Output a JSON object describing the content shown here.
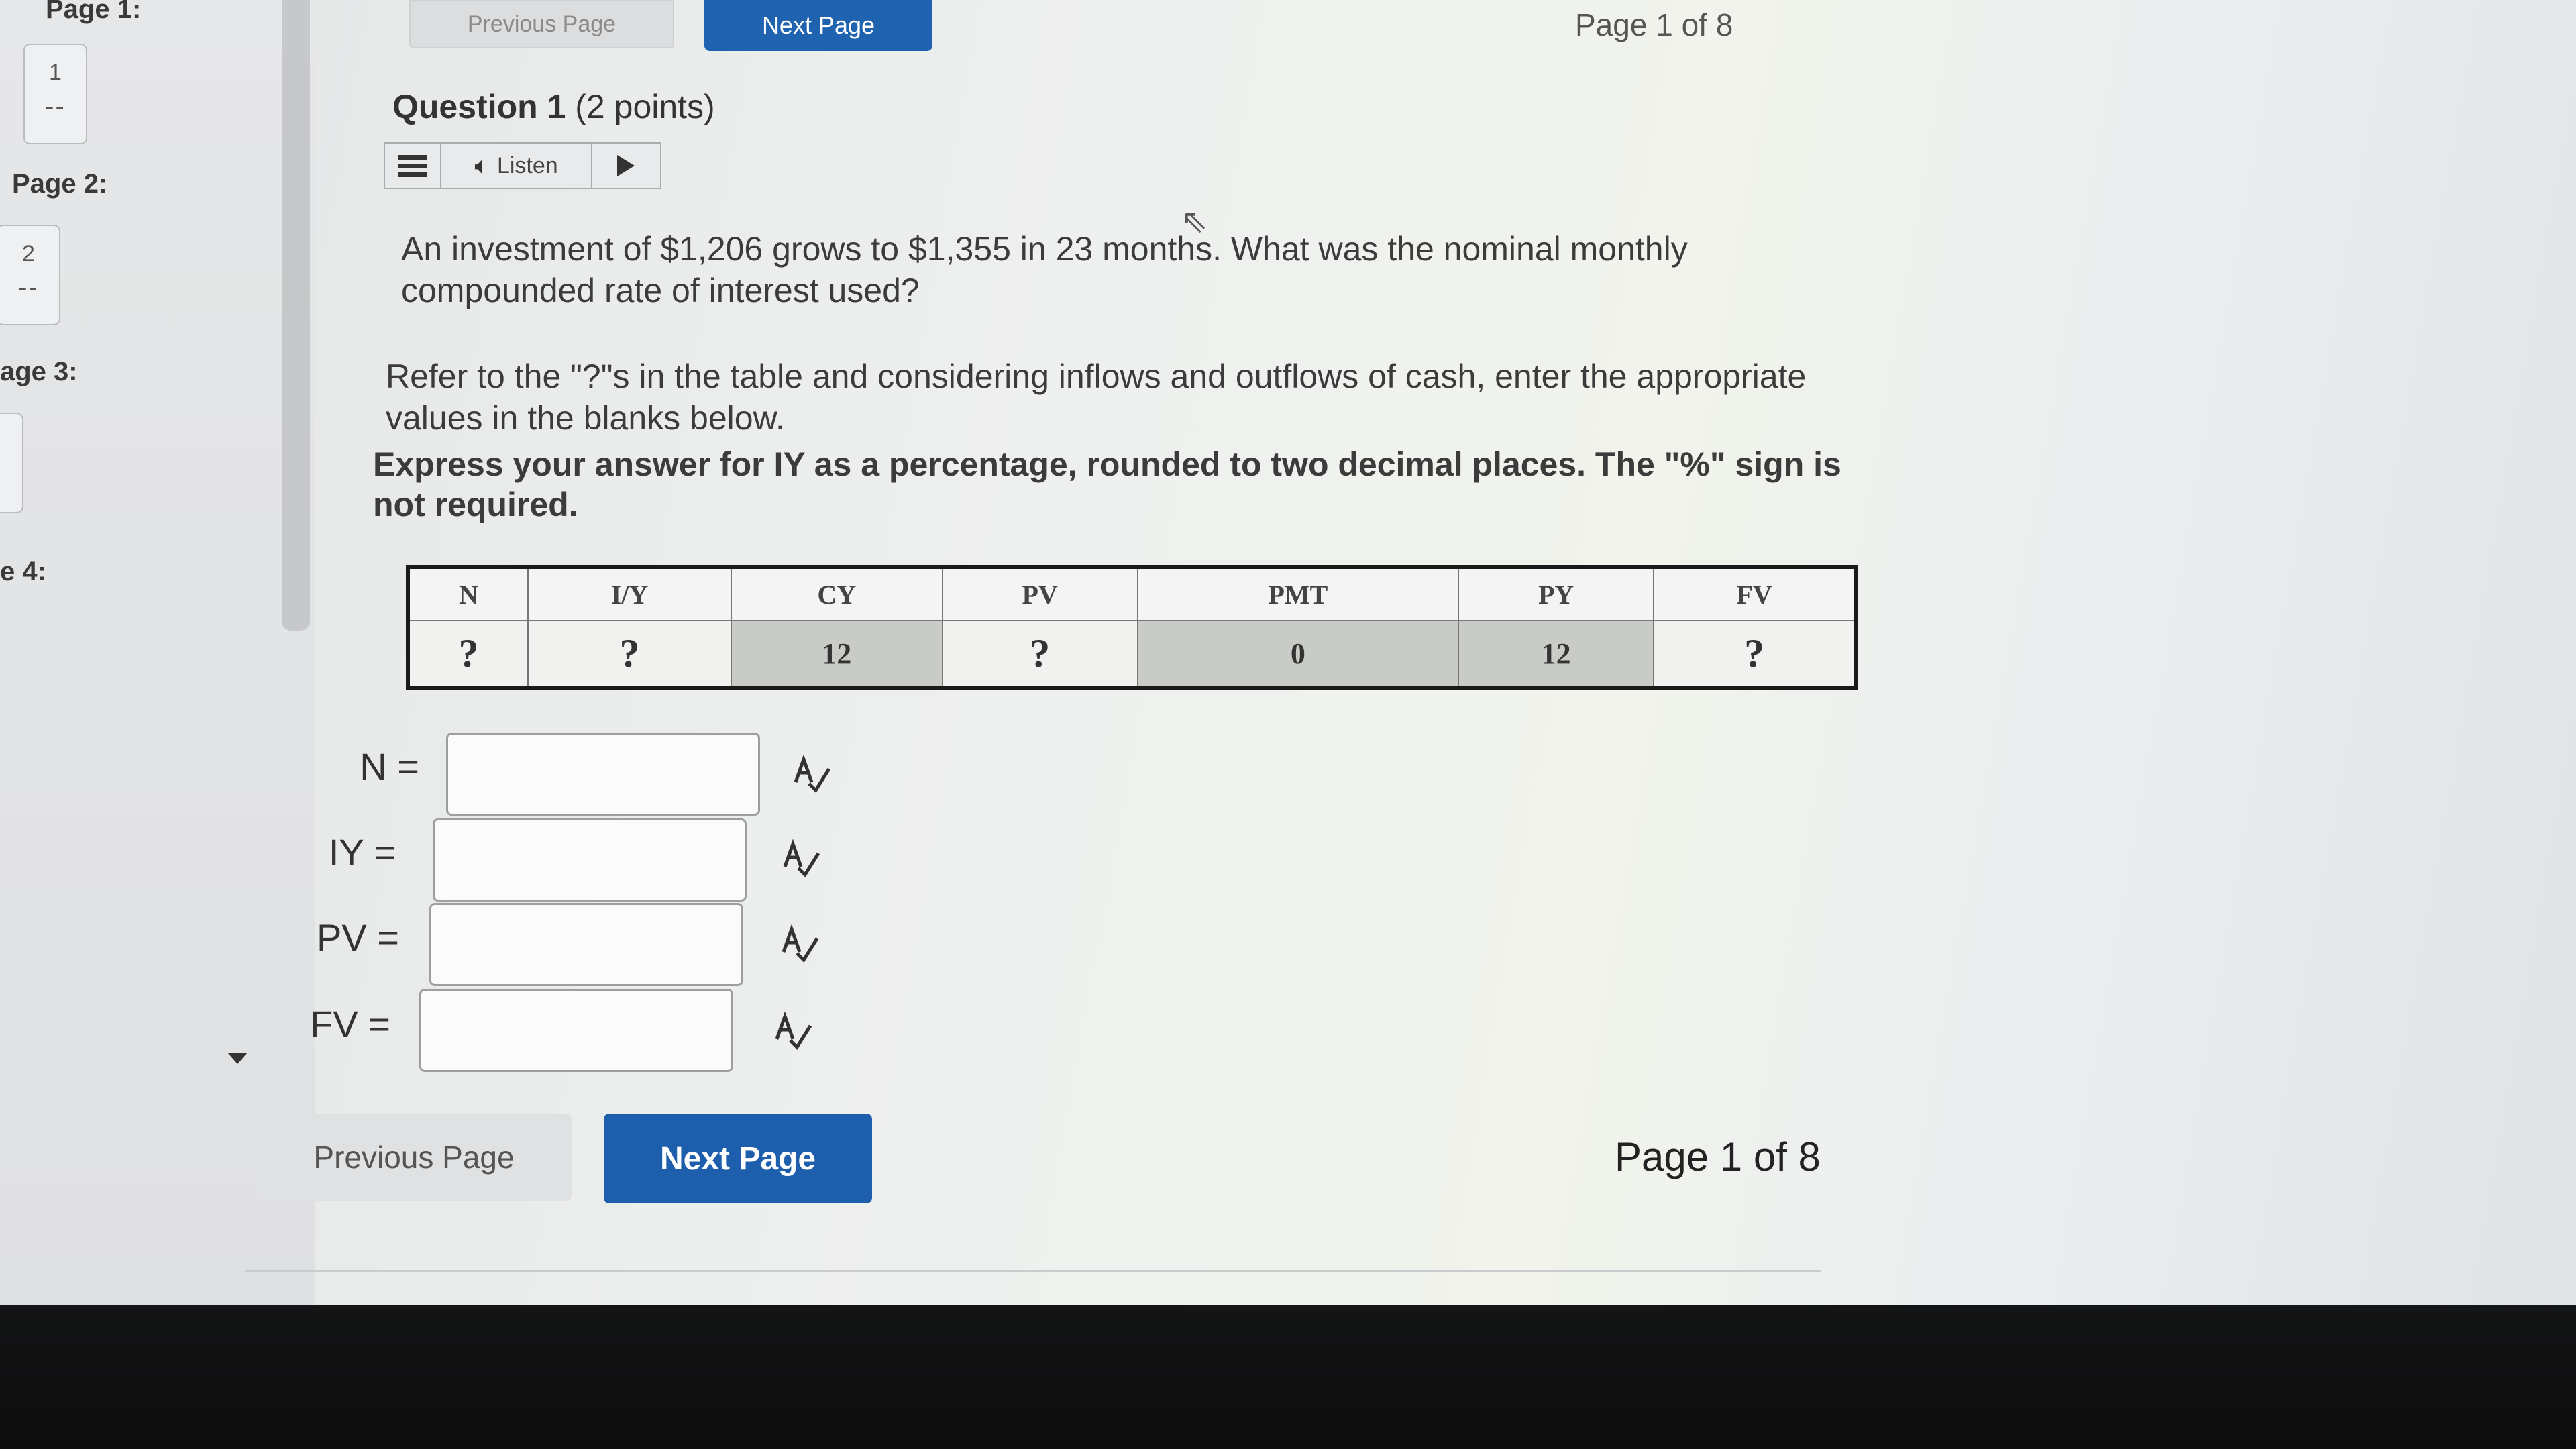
{
  "sidebar": {
    "pages": [
      {
        "label": "Page 1:",
        "number": "1",
        "dash": "--"
      },
      {
        "label": "Page 2:",
        "number": "2",
        "dash": "--"
      },
      {
        "label": "age 3:",
        "number": "",
        "dash": ""
      },
      {
        "label": "e 4:",
        "number": "",
        "dash": ""
      }
    ]
  },
  "nav_top": {
    "previous_label": "Previous Page",
    "next_label": "Next Page",
    "page_indicator": "Page 1 of 8"
  },
  "question": {
    "title": "Question 1",
    "points": "(2 points)",
    "listen_label": "Listen",
    "text": "An investment of $1,206 grows to $1,355 in 23 months. What was the nominal monthly compounded rate of interest used?",
    "instruction": "Refer to the \"?\"s in the table and considering inflows and outflows of cash, enter the appropriate values in the blanks below.",
    "emphasis": "Express your answer for IY as a percentage, rounded to two decimal places. The \"%\" sign is not required."
  },
  "table": {
    "headers": [
      "N",
      "I/Y",
      "CY",
      "PV",
      "PMT",
      "PY",
      "FV"
    ],
    "values": [
      "?",
      "?",
      "12",
      "?",
      "0",
      "12",
      "?"
    ]
  },
  "answers": [
    {
      "label": "N =",
      "value": ""
    },
    {
      "label": "IY =",
      "value": ""
    },
    {
      "label": "PV =",
      "value": ""
    },
    {
      "label": "FV =",
      "value": ""
    }
  ],
  "nav_bottom": {
    "previous_label": "Previous Page",
    "next_label": "Next Page",
    "page_indicator": "Page 1 of 8"
  },
  "colors": {
    "primary_button": "#1e62b0",
    "background": "#eef0ef",
    "bezel": "#0f1011"
  },
  "icons": [
    "hamburger-menu-icon",
    "speaker-icon",
    "play-icon",
    "spellcheck-icon",
    "mouse-cursor-icon",
    "scroll-down-arrow-icon"
  ]
}
